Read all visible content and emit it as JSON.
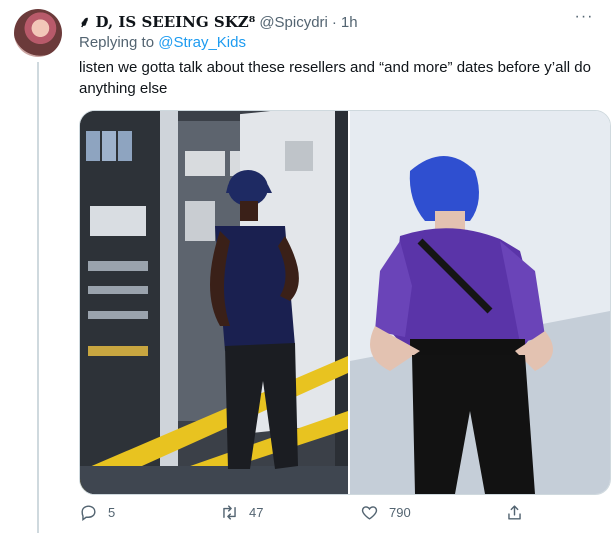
{
  "tweet": {
    "display_name": "⸙ D, IS SEEING SKZ⁸",
    "handle": "@Spicydri",
    "separator": "·",
    "time": "1h",
    "more_label": "···",
    "replying_prefix": "Replying to ",
    "replying_to": "@Stray_Kids",
    "text": "listen we gotta talk about these resellers and “and more” dates before y’all do anything else"
  },
  "actions": {
    "reply_count": "5",
    "retweet_count": "47",
    "like_count": "790"
  },
  "icons": {
    "reply": "reply-icon",
    "retweet": "retweet-icon",
    "like": "heart-icon",
    "share": "share-icon"
  },
  "colors": {
    "link": "#1d9bf0",
    "secondary_text": "#536471",
    "thread_line": "#cfd9de"
  }
}
